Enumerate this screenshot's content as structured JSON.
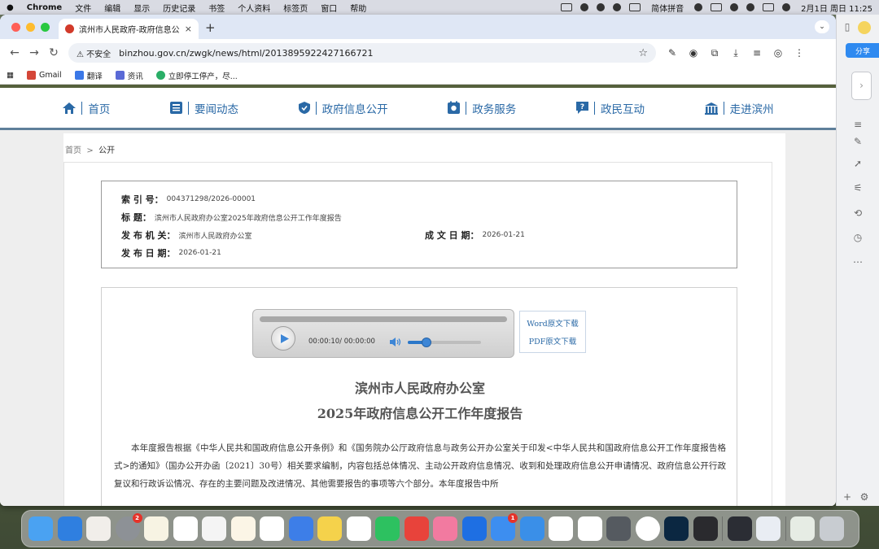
{
  "menubar": {
    "apple": "",
    "app": "Chrome",
    "menus": [
      "文件",
      "编辑",
      "显示",
      "历史记录",
      "书签",
      "个人资料",
      "标签页",
      "窗口",
      "帮助"
    ],
    "ime": "简体拼音",
    "datetime": "2月1日 周日  11:25"
  },
  "browser": {
    "tab_title": "滨州市人民政府-政府信息公开",
    "tab_close": "×",
    "new_tab": "+",
    "security_label": "不安全",
    "url": "binzhou.gov.cn/zwgk/news/html/2013895922427166721",
    "bookmarks": [
      "Gmail",
      "翻译",
      "资讯",
      "立即停工停产，尽..."
    ]
  },
  "site": {
    "nav": [
      {
        "label": "首页",
        "icon": "home-icon"
      },
      {
        "label": "要闻动态",
        "icon": "news-icon"
      },
      {
        "label": "政府信息公开",
        "icon": "shield-icon"
      },
      {
        "label": "政务服务",
        "icon": "service-icon"
      },
      {
        "label": "政民互动",
        "icon": "question-icon"
      },
      {
        "label": "走进滨州",
        "icon": "building-icon"
      }
    ],
    "breadcrumb": {
      "home": "首页",
      "sep": ">",
      "current": "公开"
    }
  },
  "meta": {
    "index_label": "索  引  号：",
    "index_value": "004371298/2026-00001",
    "title_label": "标      题：",
    "title_value": "滨州市人民政府办公室2025年政府信息公开工作年度报告",
    "publisher_label": "发 布 机 关：",
    "publisher_value": "滨州市人民政府办公室",
    "written_label": "成 文 日 期：",
    "written_value": "2026-01-21",
    "pubdate_label": "发 布 日 期：",
    "pubdate_value": "2026-01-21"
  },
  "player": {
    "time": "00:00:10/ 00:00:00",
    "volume": 0.25,
    "progress": 0
  },
  "downloads": {
    "word": "Word原文下载",
    "pdf": "PDF原文下载"
  },
  "document": {
    "title_line1": "滨州市人民政府办公室",
    "title_line2": "2025年政府信息公开工作年度报告",
    "paragraph": "本年度报告根据《中华人民共和国政府信息公开条例》和《国务院办公厅政府信息与政务公开办公室关于印发<中华人民共和国政府信息公开工作年度报告格式>的通知》（国办公开办函〔2021〕30号）相关要求编制，内容包括总体情况、主动公开政府信息情况、收到和处理政府信息公开申请情况、政府信息公开行政复议和行政诉讼情况、存在的主要问题及改进情况、其他需要报告的事项等六个部分。本年度报告中所"
  },
  "sidebar": {
    "share": "分享"
  },
  "dock": {
    "badge_settings": "2",
    "badge_music": "1"
  },
  "colors": {
    "link_blue": "#2a69a6",
    "nav_border": "#5f7f9a"
  }
}
